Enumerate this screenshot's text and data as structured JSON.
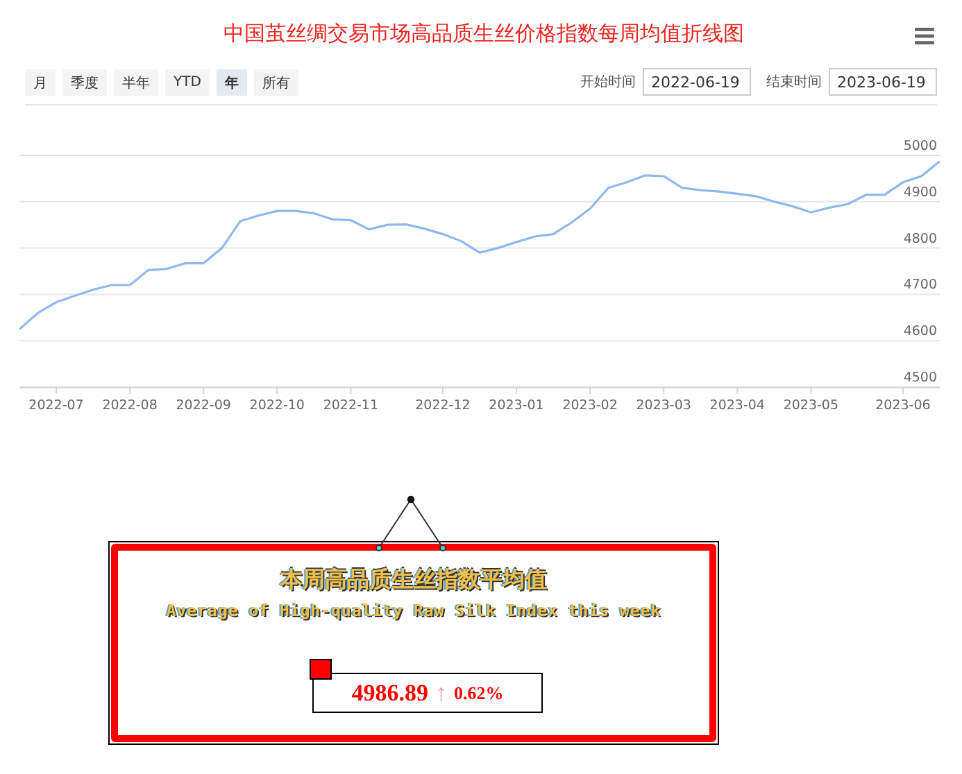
{
  "title": "中国茧丝绸交易市场高品质生丝价格指数每周均值折线图",
  "ranges": [
    {
      "label": "月",
      "selected": false
    },
    {
      "label": "季度",
      "selected": false
    },
    {
      "label": "半年",
      "selected": false
    },
    {
      "label": "YTD",
      "selected": false
    },
    {
      "label": "年",
      "selected": true
    },
    {
      "label": "所有",
      "selected": false
    }
  ],
  "date_range": {
    "start_label": "开始时间",
    "start": "2022-06-19",
    "end_label": "结束时间",
    "end": "2023-06-19"
  },
  "chart_data": {
    "type": "line",
    "grid": true,
    "ylim": [
      4500,
      5000
    ],
    "yticks": [
      4500,
      4600,
      4700,
      4800,
      4900,
      5000
    ],
    "categories": [
      null,
      null,
      "2022-07",
      null,
      null,
      null,
      "2022-08",
      null,
      null,
      null,
      "2022-09",
      null,
      null,
      null,
      "2022-10",
      null,
      null,
      null,
      "2022-11",
      null,
      null,
      null,
      null,
      "2022-12",
      null,
      null,
      null,
      "2023-01",
      null,
      null,
      null,
      "2023-02",
      null,
      null,
      null,
      "2023-03",
      null,
      null,
      null,
      "2023-04",
      null,
      null,
      null,
      "2023-05",
      null,
      null,
      null,
      null,
      "2023-06",
      null,
      null
    ],
    "series": [
      {
        "color": "#8fb8ee",
        "values": [
          4625,
          4660,
          4683,
          4697,
          4710,
          4720,
          4720,
          4752,
          4755,
          4767,
          4767,
          4800,
          4858,
          4870,
          4880,
          4880,
          4875,
          4862,
          4860,
          4840,
          4850,
          4851,
          4842,
          4830,
          4815,
          4790,
          4800,
          4813,
          4825,
          4830,
          4855,
          4885,
          4930,
          4942,
          4957,
          4955,
          4930,
          4925,
          4922,
          4917,
          4912,
          4900,
          4890,
          4877,
          4887,
          4895,
          4915,
          4915,
          4942,
          4955,
          4987
        ]
      }
    ]
  },
  "summary": {
    "title": "本周高品质生丝指数平均值",
    "subtitle": "Average of High-quality Raw Silk Index this week",
    "value": "4986.89",
    "arrow": "↑",
    "change": "0.62%"
  }
}
